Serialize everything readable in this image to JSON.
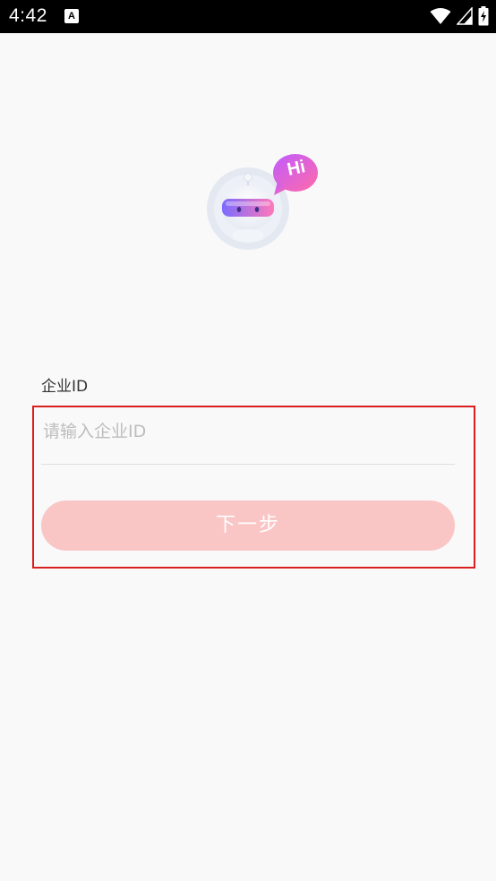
{
  "status_bar": {
    "time": "4:42",
    "notification_icon": "A"
  },
  "logo": {
    "bubble_text": "Hi"
  },
  "form": {
    "label": "企业ID",
    "placeholder": "请输入企业ID",
    "value": "",
    "next_button_label": "下一步"
  },
  "colors": {
    "button_bg": "#fac5c5",
    "highlight_border": "#d9201f",
    "bubble_gradient": [
      "#c05cff",
      "#ff6aa8"
    ],
    "visor_gradient": [
      "#7b6bff",
      "#ff78b9"
    ]
  },
  "icons": [
    "notification-a-icon",
    "wifi-icon",
    "signal-icon",
    "battery-charging-icon",
    "robot-mascot-icon",
    "hi-speech-bubble-icon"
  ]
}
